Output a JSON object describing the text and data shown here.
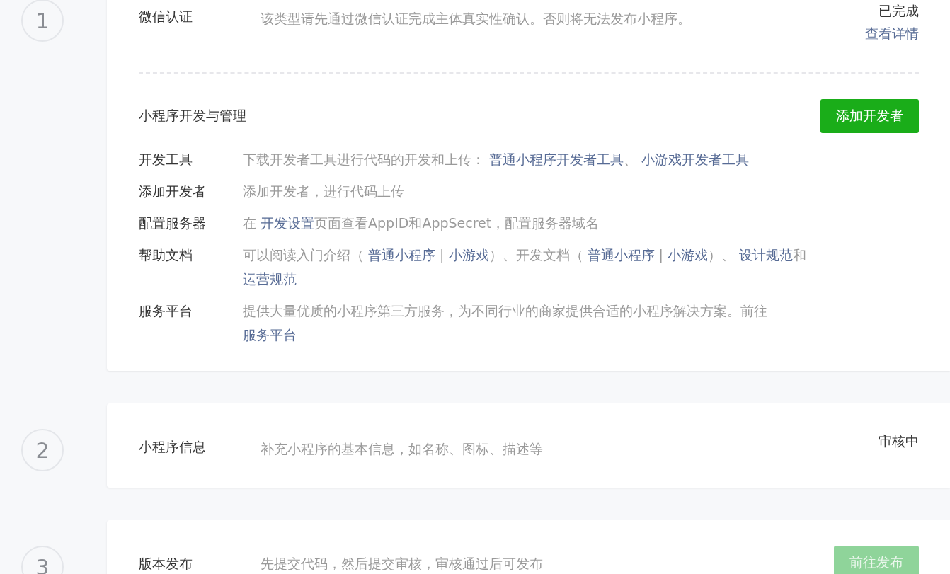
{
  "steps": [
    {
      "number": "1",
      "title": "微信认证",
      "description": "该类型请先通过微信认证完成主体真实性确认。否则将无法发布小程序。",
      "status": "已完成",
      "status_link": "查看详情",
      "section": {
        "heading": "小程序开发与管理",
        "button": {
          "label": "添加开发者",
          "disabled": false
        },
        "rows": [
          {
            "label": "开发工具",
            "parts": [
              {
                "kind": "text",
                "text": "下载开发者工具进行代码的开发和上传： "
              },
              {
                "kind": "link",
                "text": "普通小程序开发者工具"
              },
              {
                "kind": "text",
                "text": "、 "
              },
              {
                "kind": "link",
                "text": "小游戏开发者工具"
              }
            ]
          },
          {
            "label": "添加开发者",
            "parts": [
              {
                "kind": "text",
                "text": "添加开发者，进行代码上传"
              }
            ]
          },
          {
            "label": "配置服务器",
            "parts": [
              {
                "kind": "text",
                "text": "在 "
              },
              {
                "kind": "link",
                "text": "开发设置"
              },
              {
                "kind": "text",
                "text": "页面查看AppID和AppSecret，配置服务器域名"
              }
            ]
          },
          {
            "label": "帮助文档",
            "parts": [
              {
                "kind": "text",
                "text": "可以阅读入门介绍（ "
              },
              {
                "kind": "link",
                "text": "普通小程序"
              },
              {
                "kind": "text",
                "text": " | "
              },
              {
                "kind": "link",
                "text": "小游戏"
              },
              {
                "kind": "text",
                "text": "）、开发文档（ "
              },
              {
                "kind": "link",
                "text": "普通小程序"
              },
              {
                "kind": "text",
                "text": " | "
              },
              {
                "kind": "link",
                "text": "小游戏"
              },
              {
                "kind": "text",
                "text": "）、 "
              },
              {
                "kind": "link",
                "text": "设计规范"
              },
              {
                "kind": "text",
                "text": "和 "
              },
              {
                "kind": "link",
                "text": "运营规范"
              }
            ]
          },
          {
            "label": "服务平台",
            "parts": [
              {
                "kind": "text",
                "text": "提供大量优质的小程序第三方服务，为不同行业的商家提供合适的小程序解决方案。前往 "
              },
              {
                "kind": "link",
                "text": "服务平台"
              }
            ]
          }
        ]
      }
    },
    {
      "number": "2",
      "title": "小程序信息",
      "description": "补充小程序的基本信息，如名称、图标、描述等",
      "status": "审核中"
    },
    {
      "number": "3",
      "title": "版本发布",
      "description": "先提交代码，然后提交审核，审核通过后可发布",
      "button": {
        "label": "前往发布",
        "disabled": true
      }
    }
  ]
}
